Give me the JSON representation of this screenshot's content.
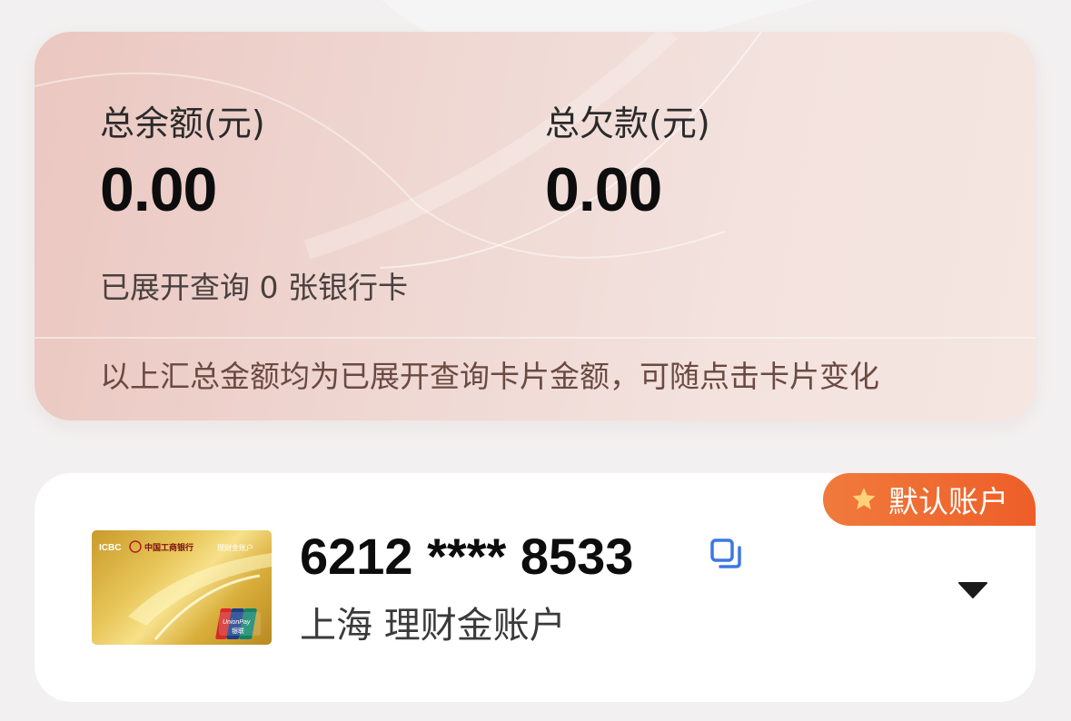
{
  "summary": {
    "total_balance_label": "总余额(元)",
    "total_balance_value": "0.00",
    "total_debt_label": "总欠款(元)",
    "total_debt_value": "0.00",
    "expanded_info": "已展开查询 0 张银行卡",
    "note": "以上汇总金额均为已展开查询卡片金额，可随点击卡片变化"
  },
  "account": {
    "default_badge": "默认账户",
    "card_number": "6212 **** 8533",
    "description": "上海 理财金账户",
    "card_image": {
      "bank_short": "ICBC",
      "bank_name": "中国工商银行",
      "product_name": "理财金账户",
      "network": "UnionPay",
      "network_cn": "银联"
    },
    "icons": {
      "badge": "star-icon",
      "copy": "copy-icon",
      "toggle": "caret-down-icon"
    }
  },
  "colors": {
    "badge_orange": "#ee6a30",
    "copy_blue": "#3a78e6",
    "summary_bg": "#efd7d2"
  }
}
